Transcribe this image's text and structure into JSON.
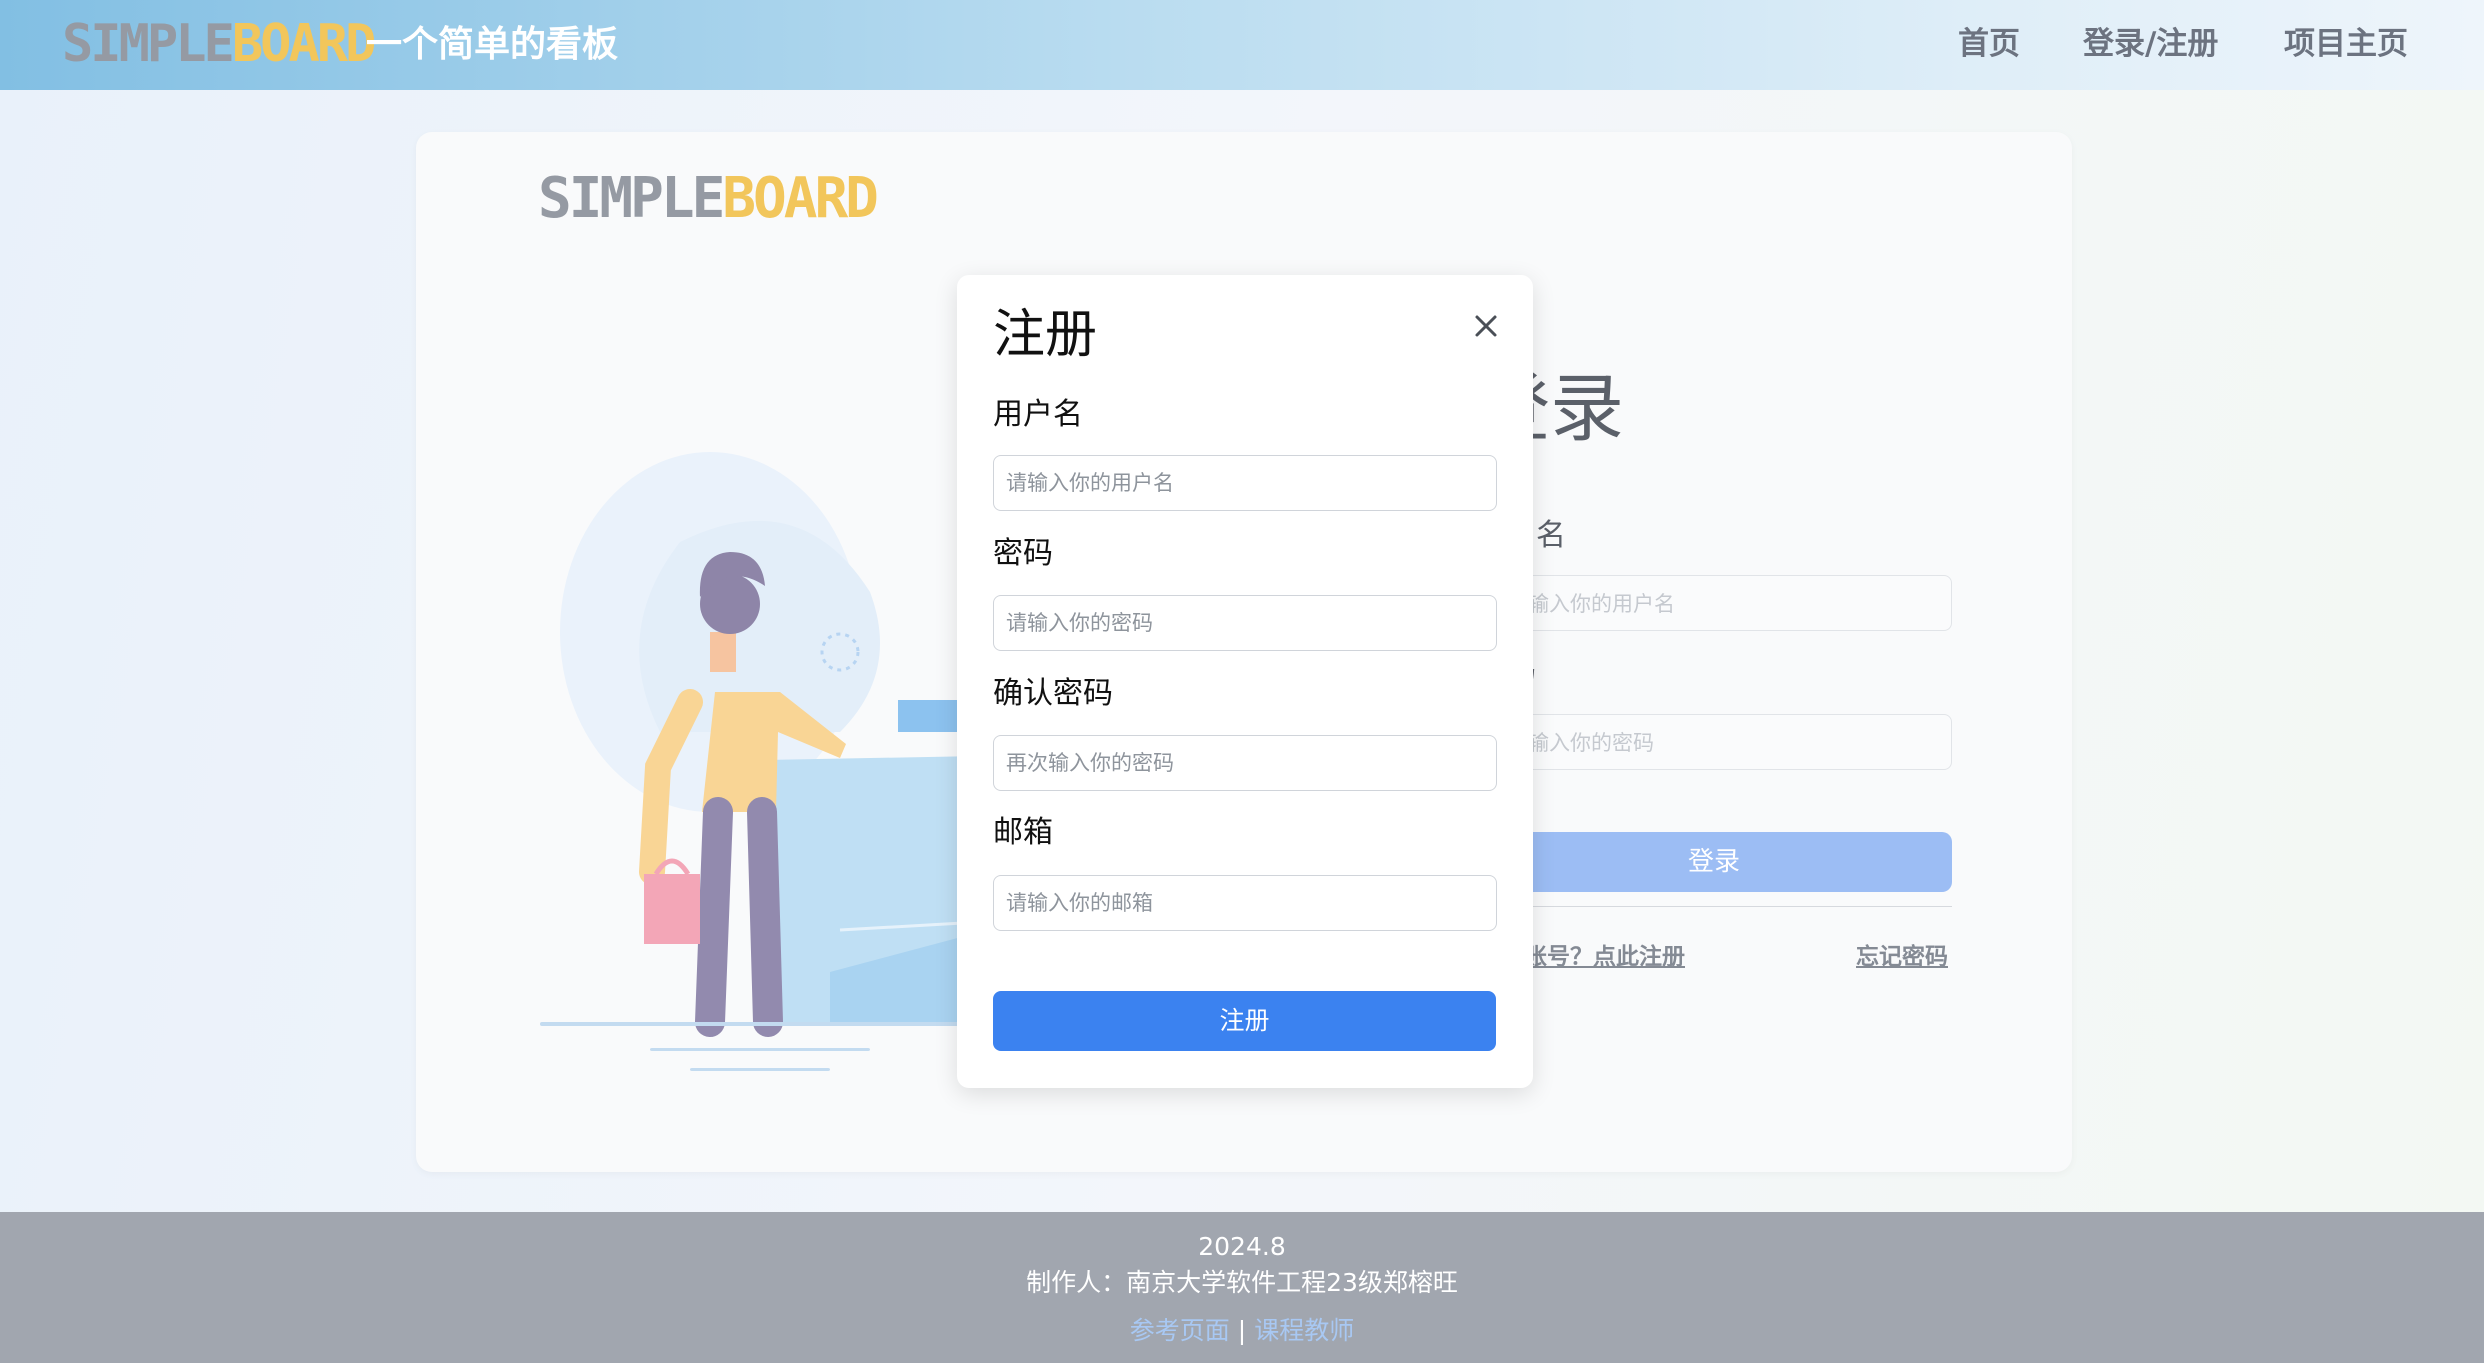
{
  "navbar": {
    "logo": {
      "part1": "SIMPLE",
      "part2": "BOARD"
    },
    "subtitle": "一个简单的看板",
    "links": [
      "首页",
      "登录/注册",
      "项目主页"
    ]
  },
  "card": {
    "logo": {
      "part1": "SIMPLE",
      "part2": "BOARD"
    }
  },
  "login": {
    "title": "登录",
    "username_label": "用户名",
    "username_placeholder": "请输入你的用户名",
    "password_label": "密码",
    "password_placeholder": "请输入你的密码",
    "login_button": "登录",
    "register_link": "没有账号？点此注册",
    "forgot_link": "忘记密码"
  },
  "modal": {
    "title": "注册",
    "close_icon": "close-icon",
    "fields": [
      {
        "label": "用户名",
        "placeholder": "请输入你的用户名"
      },
      {
        "label": "密码",
        "placeholder": "请输入你的密码"
      },
      {
        "label": "确认密码",
        "placeholder": "再次输入你的密码"
      },
      {
        "label": "邮箱",
        "placeholder": "请输入你的邮箱"
      }
    ],
    "submit": "注册"
  },
  "footer": {
    "date": "2024.8",
    "author": "制作人：南京大学软件工程23级郑榕旺",
    "links": [
      "参考页面",
      "课程教师"
    ],
    "separator": "|"
  },
  "colors": {
    "accent": "#3b82f0",
    "logo_gray": "#959aa3",
    "logo_yellow": "#f2c65b",
    "footer_bg": "#a1a6af"
  }
}
